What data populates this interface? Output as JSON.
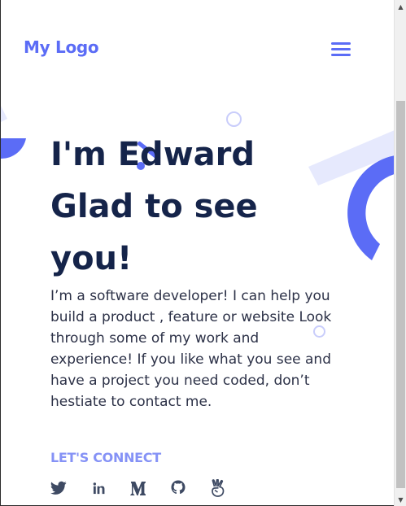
{
  "header": {
    "logo": "My Logo",
    "menu_icon": "hamburger-menu-icon"
  },
  "hero": {
    "title_lines": [
      "I'm Edward",
      "Glad to see",
      "you!"
    ],
    "description": "I’m a software developer! I can help you build a product , feature or website Look through some of my work and experience! If you like what you see and have a project you need coded, don’t hestiate to contact me."
  },
  "connect": {
    "heading": "LET'S CONNECT",
    "links": [
      "twitter-icon",
      "linkedin-icon",
      "medium-icon",
      "github-icon",
      "angellist-icon"
    ]
  },
  "colors": {
    "accent": "#5b6cf6",
    "accent_light": "#8592f6",
    "accent_pale": "#e6e9fd",
    "title": "#15244a",
    "body_text": "#2c3147",
    "icon": "#3e4a63"
  }
}
